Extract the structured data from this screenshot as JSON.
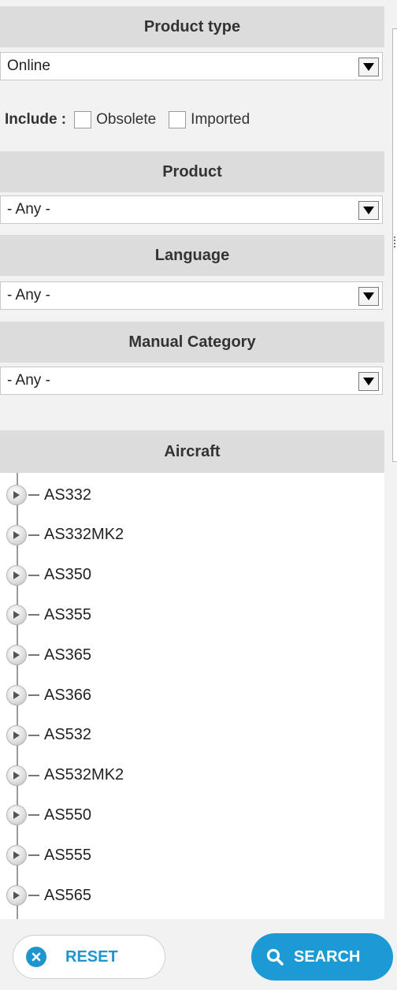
{
  "product_type": {
    "header": "Product type",
    "selected": "Online"
  },
  "include": {
    "label": "Include :",
    "options": [
      {
        "label": "Obsolete",
        "checked": false
      },
      {
        "label": "Imported",
        "checked": false
      }
    ]
  },
  "product": {
    "header": "Product",
    "selected": "- Any -"
  },
  "language": {
    "header": "Language",
    "selected": "- Any -"
  },
  "manual_category": {
    "header": "Manual Category",
    "selected": "- Any -"
  },
  "aircraft": {
    "header": "Aircraft",
    "items": [
      "AS332",
      "AS332MK2",
      "AS350",
      "AS355",
      "AS365",
      "AS366",
      "AS532",
      "AS532MK2",
      "AS550",
      "AS555",
      "AS565"
    ]
  },
  "buttons": {
    "reset": "RESET",
    "search": "SEARCH"
  },
  "colors": {
    "accent": "#1c9ad6",
    "header_bg": "#dcdcdc",
    "panel_bg": "#f2f2f2"
  },
  "icons": {
    "dropdown": "triangle-down-icon",
    "tree_expand": "expand-arrow-icon",
    "reset": "close-circle-icon",
    "search": "magnifier-icon"
  }
}
